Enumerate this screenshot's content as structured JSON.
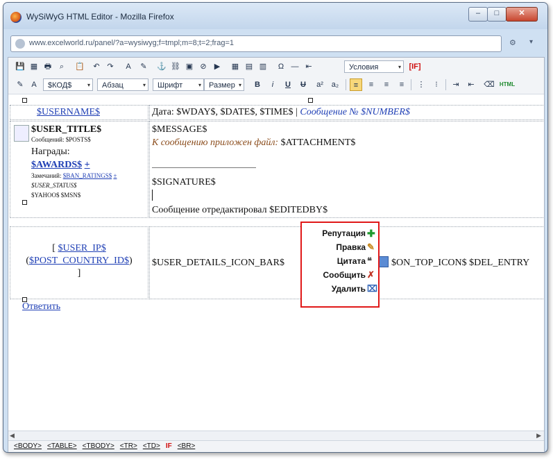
{
  "window": {
    "title": "WySiWyG HTML Editor - Mozilla Firefox",
    "controls": {
      "minimize": "–",
      "maximize": "□",
      "close": "✕"
    }
  },
  "navbar": {
    "url": "www.excelworld.ru/panel/?a=wysiwyg;f=tmpl;m=8;t=2;frag=1",
    "tools_icon": "wrench-icon",
    "dropdown_icon": "▾"
  },
  "toolbar1": {
    "icons": [
      "save-icon",
      "preview-icon",
      "print-icon",
      "find-icon",
      "paste-icon",
      "undo-icon",
      "redo-icon",
      "text-color-icon",
      "highlight-icon",
      "anchor-icon",
      "link-icon",
      "image-icon",
      "flash-icon",
      "media-icon",
      "table-icon",
      "table-props-icon",
      "template-icon",
      "symbol-icon",
      "hr-icon",
      "nbsp-icon"
    ],
    "glyphs": [
      "💾",
      "▦",
      "🖶",
      "⌕",
      "📋",
      "↶",
      "↷",
      "A",
      "✎",
      "⚓",
      "⛓",
      "▣",
      "⊘",
      "▶",
      "▦",
      "▤",
      "▥",
      "Ω",
      "—",
      "⇤"
    ],
    "condition_select": "Условия",
    "if_button": "[IF]"
  },
  "toolbar2": {
    "code_select": "$КОД$",
    "paragraph_select": "Абзац",
    "font_select": "Шрифт",
    "size_select": "Размер",
    "bold": "B",
    "italic": "i",
    "underline": "U",
    "strike": "U",
    "superscript": "a²",
    "subscript": "a₂",
    "html_button": "HTML"
  },
  "editor": {
    "username": "$USERNAME$",
    "date_line": "Дата: $WDAY$, $DATE$, $TIME$ |",
    "message_number": "Сообщение № $NUMBER$",
    "user_title": "$USER_TITLE$",
    "posts": "Сообщений: $POSTS$",
    "awards_label": "Награды:",
    "awards": "$AWARDS$",
    "awards_plus": "+",
    "ban_label": "Замечаний:",
    "ban_ratings": "$BAN_RATINGS$",
    "ban_plus": "±",
    "user_status": "$USER_STATUS$",
    "yahoo_msn": "$YAHOO$ $MSN$",
    "message": "$MESSAGE$",
    "attachment_label": "К сообщению приложен файл:",
    "attachment": "$ATTACHMENT$",
    "signature": "$SIGNATURE$",
    "edited_by": "Сообщение отредактировал $EDITEDBY$",
    "user_ip_open": "[",
    "user_ip": "$USER_IP$",
    "country_open": "(",
    "country": "$POST_COUNTRY_ID$",
    "country_close": ")",
    "user_ip_close": "]",
    "details_icon_bar": "$USER_DETAILS_ICON_BAR$",
    "on_top_del": "$ON_TOP_ICON$ $DEL_ENTRY",
    "reply_link": "Ответить"
  },
  "popup": {
    "items": [
      {
        "label": "Репутация",
        "icon": "plus-icon"
      },
      {
        "label": "Правка",
        "icon": "edit-icon"
      },
      {
        "label": "Цитата",
        "icon": "quote-icon"
      },
      {
        "label": "Сообщить",
        "icon": "report-icon"
      },
      {
        "label": "Удалить",
        "icon": "delete-icon"
      }
    ]
  },
  "statusbar": {
    "crumbs": [
      "<BODY>",
      "<TABLE>",
      "<TBODY>",
      "<TR>",
      "<TD>",
      "IF",
      "<BR>"
    ]
  }
}
